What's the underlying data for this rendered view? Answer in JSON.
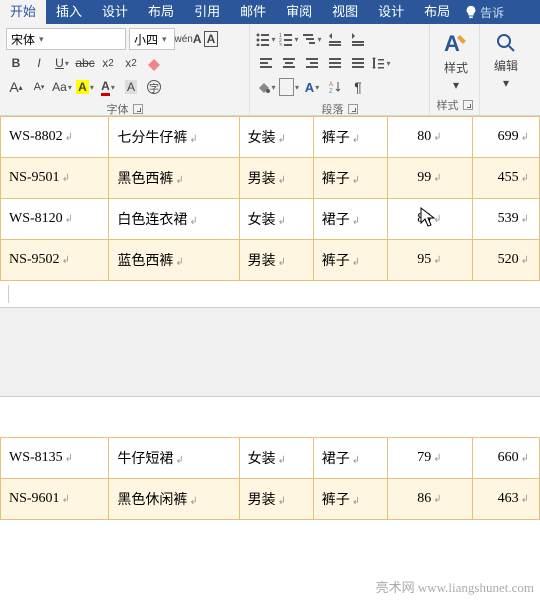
{
  "tabs": [
    "开始",
    "插入",
    "设计",
    "布局",
    "引用",
    "邮件",
    "审阅",
    "视图",
    "设计",
    "布局"
  ],
  "active_tab": 0,
  "tell_me": "告诉",
  "font": {
    "name": "宋体",
    "size": "小四"
  },
  "groups": {
    "font": "字体",
    "paragraph": "段落",
    "styles": "样式",
    "editing": "编辑"
  },
  "big_buttons": {
    "styles": "样式",
    "editing": "编辑"
  },
  "table1": [
    {
      "code": "WS-8802",
      "name": "七分牛仔裤",
      "cat": "女装",
      "type": "裤子",
      "qty": "80",
      "price": "699",
      "shade": "even"
    },
    {
      "code": "NS-9501",
      "name": "黑色西裤",
      "cat": "男装",
      "type": "裤子",
      "qty": "99",
      "price": "455",
      "shade": "odd"
    },
    {
      "code": "WS-8120",
      "name": "白色连衣裙",
      "cat": "女装",
      "type": "裙子",
      "qty": "89",
      "price": "539",
      "shade": "even"
    },
    {
      "code": "NS-9502",
      "name": "蓝色西裤",
      "cat": "男装",
      "type": "裤子",
      "qty": "95",
      "price": "520",
      "shade": "odd"
    }
  ],
  "table2": [
    {
      "code": "WS-8135",
      "name": "牛仔短裙",
      "cat": "女装",
      "type": "裙子",
      "qty": "79",
      "price": "660",
      "shade": "even"
    },
    {
      "code": "NS-9601",
      "name": "黑色休闲裤",
      "cat": "男装",
      "type": "裤子",
      "qty": "86",
      "price": "463",
      "shade": "odd"
    }
  ],
  "watermark": "亮术网 www.liangshunet.com"
}
